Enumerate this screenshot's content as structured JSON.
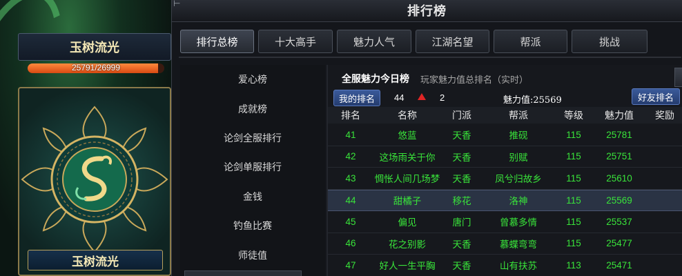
{
  "character": {
    "name": "玉树流光",
    "hp_text": "25791/26999",
    "hp_fraction": 0.955,
    "card_name": "玉树流光"
  },
  "window": {
    "title": "排行榜",
    "corner_glyph": "⊢"
  },
  "tabs": [
    {
      "label": "排行总榜",
      "active": true
    },
    {
      "label": "十大高手",
      "active": false
    },
    {
      "label": "魅力人气",
      "active": false
    },
    {
      "label": "江湖名望",
      "active": false
    },
    {
      "label": "帮派",
      "active": false
    },
    {
      "label": "挑战",
      "active": false
    }
  ],
  "categories": [
    "爱心榜",
    "成就榜",
    "论剑全服排行",
    "论剑单服排行",
    "金钱",
    "钓鱼比赛",
    "师徒值"
  ],
  "board": {
    "title": "全服魅力今日榜",
    "subtitle": "玩家魅力值总排名（实时）",
    "my_rank_label": "我的排名",
    "my_rank": "44",
    "rank_change": "2",
    "charm_label": "魅力值:25569",
    "friend_rank_label": "好友排名"
  },
  "table": {
    "headers": [
      "排名",
      "名称",
      "门派",
      "帮派",
      "等级",
      "魅力值",
      "奖励"
    ],
    "rows": [
      [
        "41",
        "悠蓝",
        "天香",
        "推砚",
        "115",
        "25781"
      ],
      [
        "42",
        "这场雨关于你",
        "天香",
        "别赋",
        "115",
        "25751"
      ],
      [
        "43",
        "惆怅人间几场梦",
        "天香",
        "凤兮归故乡",
        "115",
        "25610"
      ],
      [
        "44",
        "甜橘子",
        "移花",
        "洛神",
        "115",
        "25569"
      ],
      [
        "45",
        "偏见",
        "唐门",
        "曾慕多情",
        "115",
        "25537"
      ],
      [
        "46",
        "花之别影",
        "天香",
        "慕蝶弯弯",
        "115",
        "25477"
      ],
      [
        "47",
        "好人一生平胸",
        "天香",
        "山有扶苏",
        "113",
        "25471"
      ]
    ],
    "selected_index": 3
  },
  "colors": {
    "row_text": "#39e43a",
    "accent_up": "#e02525",
    "hp_bar": "#ff7a2a"
  }
}
